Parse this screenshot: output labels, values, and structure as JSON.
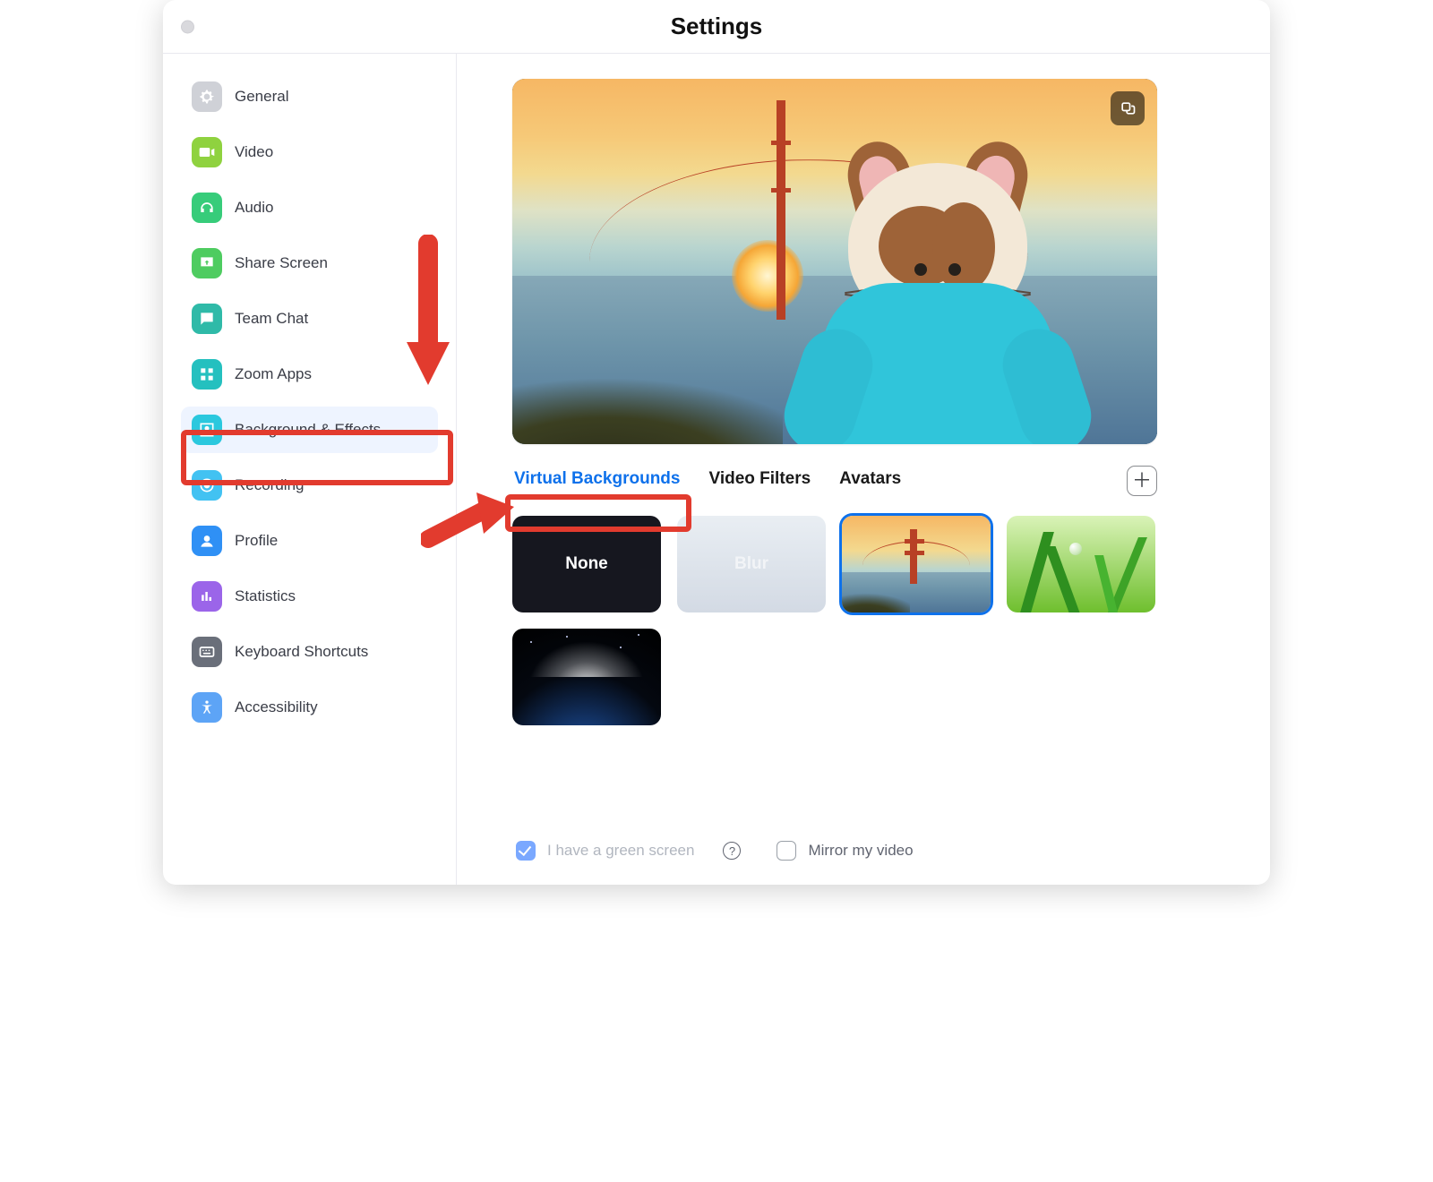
{
  "header": {
    "title": "Settings"
  },
  "sidebar": {
    "items": [
      {
        "label": "General"
      },
      {
        "label": "Video"
      },
      {
        "label": "Audio"
      },
      {
        "label": "Share Screen"
      },
      {
        "label": "Team Chat"
      },
      {
        "label": "Zoom Apps"
      },
      {
        "label": "Background & Effects"
      },
      {
        "label": "Recording"
      },
      {
        "label": "Profile"
      },
      {
        "label": "Statistics"
      },
      {
        "label": "Keyboard Shortcuts"
      },
      {
        "label": "Accessibility"
      }
    ],
    "active_index": 6,
    "icon_colors": [
      "#cfd1d7",
      "#8fd23f",
      "#37cc7a",
      "#4ecc60",
      "#2fbaa8",
      "#24c0bf",
      "#2bc8de",
      "#42c2f2",
      "#2f90f5",
      "#9b65e9",
      "#6a6f7a",
      "#5da4f6"
    ]
  },
  "tabs": {
    "items": [
      "Virtual Backgrounds",
      "Video Filters",
      "Avatars"
    ],
    "active_index": 0
  },
  "backgrounds": {
    "options": [
      {
        "name": "None",
        "kind": "none"
      },
      {
        "name": "Blur",
        "kind": "blur"
      },
      {
        "name": "Golden Gate",
        "kind": "bridge",
        "selected": true
      },
      {
        "name": "Grass",
        "kind": "grass"
      },
      {
        "name": "Earth",
        "kind": "earth"
      }
    ]
  },
  "footer": {
    "green_screen_label": "I have a green screen",
    "green_screen_checked": true,
    "mirror_label": "Mirror my video",
    "mirror_checked": false
  },
  "colors": {
    "accent": "#0e71eb",
    "annotation": "#e23b2e"
  }
}
